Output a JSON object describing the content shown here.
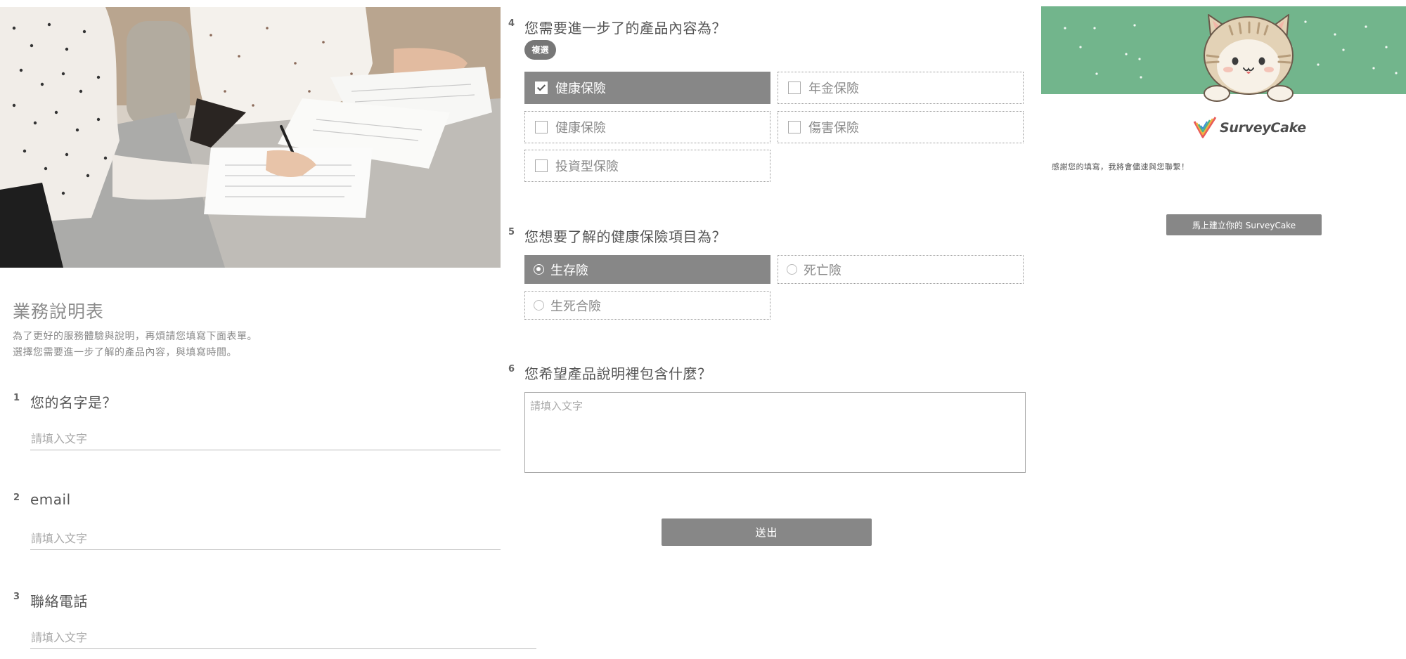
{
  "form": {
    "title": "業務說明表",
    "description_line1": "為了更好的服務體驗與說明，再煩請您填寫下面表單。",
    "description_line2": "選擇您需要進一步了解的產品內容，與填寫時間。"
  },
  "questions": [
    {
      "number": "1",
      "title": "您的名字是？",
      "placeholder": "請填入文字"
    },
    {
      "number": "2",
      "title": "email",
      "placeholder": "請填入文字"
    },
    {
      "number": "3",
      "title": "聯絡電話",
      "placeholder": "請填入文字"
    },
    {
      "number": "4",
      "title": "您需要進一步了的產品內容為？",
      "tag": "複選",
      "options": [
        {
          "label": "健康保險",
          "checked": true
        },
        {
          "label": "年金保險",
          "checked": false
        },
        {
          "label": "健康保險",
          "checked": false
        },
        {
          "label": "傷害保險",
          "checked": false
        },
        {
          "label": "投資型保險",
          "checked": false
        }
      ]
    },
    {
      "number": "5",
      "title": "您想要了解的健康保險項目為？",
      "options": [
        {
          "label": "生存險",
          "selected": true
        },
        {
          "label": "死亡險",
          "selected": false
        },
        {
          "label": "生死合險",
          "selected": false
        }
      ]
    },
    {
      "number": "6",
      "title": "您希望產品說明裡包含什麼？",
      "placeholder": "請填入文字"
    }
  ],
  "submit_label": "送出",
  "thankyou": {
    "brand": "SurveyCake",
    "message": "感謝您的填寫，我將會儘速與您聯繫！",
    "button_label": "馬上建立你的 SurveyCake",
    "banner_color": "#72b58c"
  },
  "colors": {
    "selected_option": "#878787",
    "button": "#878787",
    "text": "#555555"
  }
}
